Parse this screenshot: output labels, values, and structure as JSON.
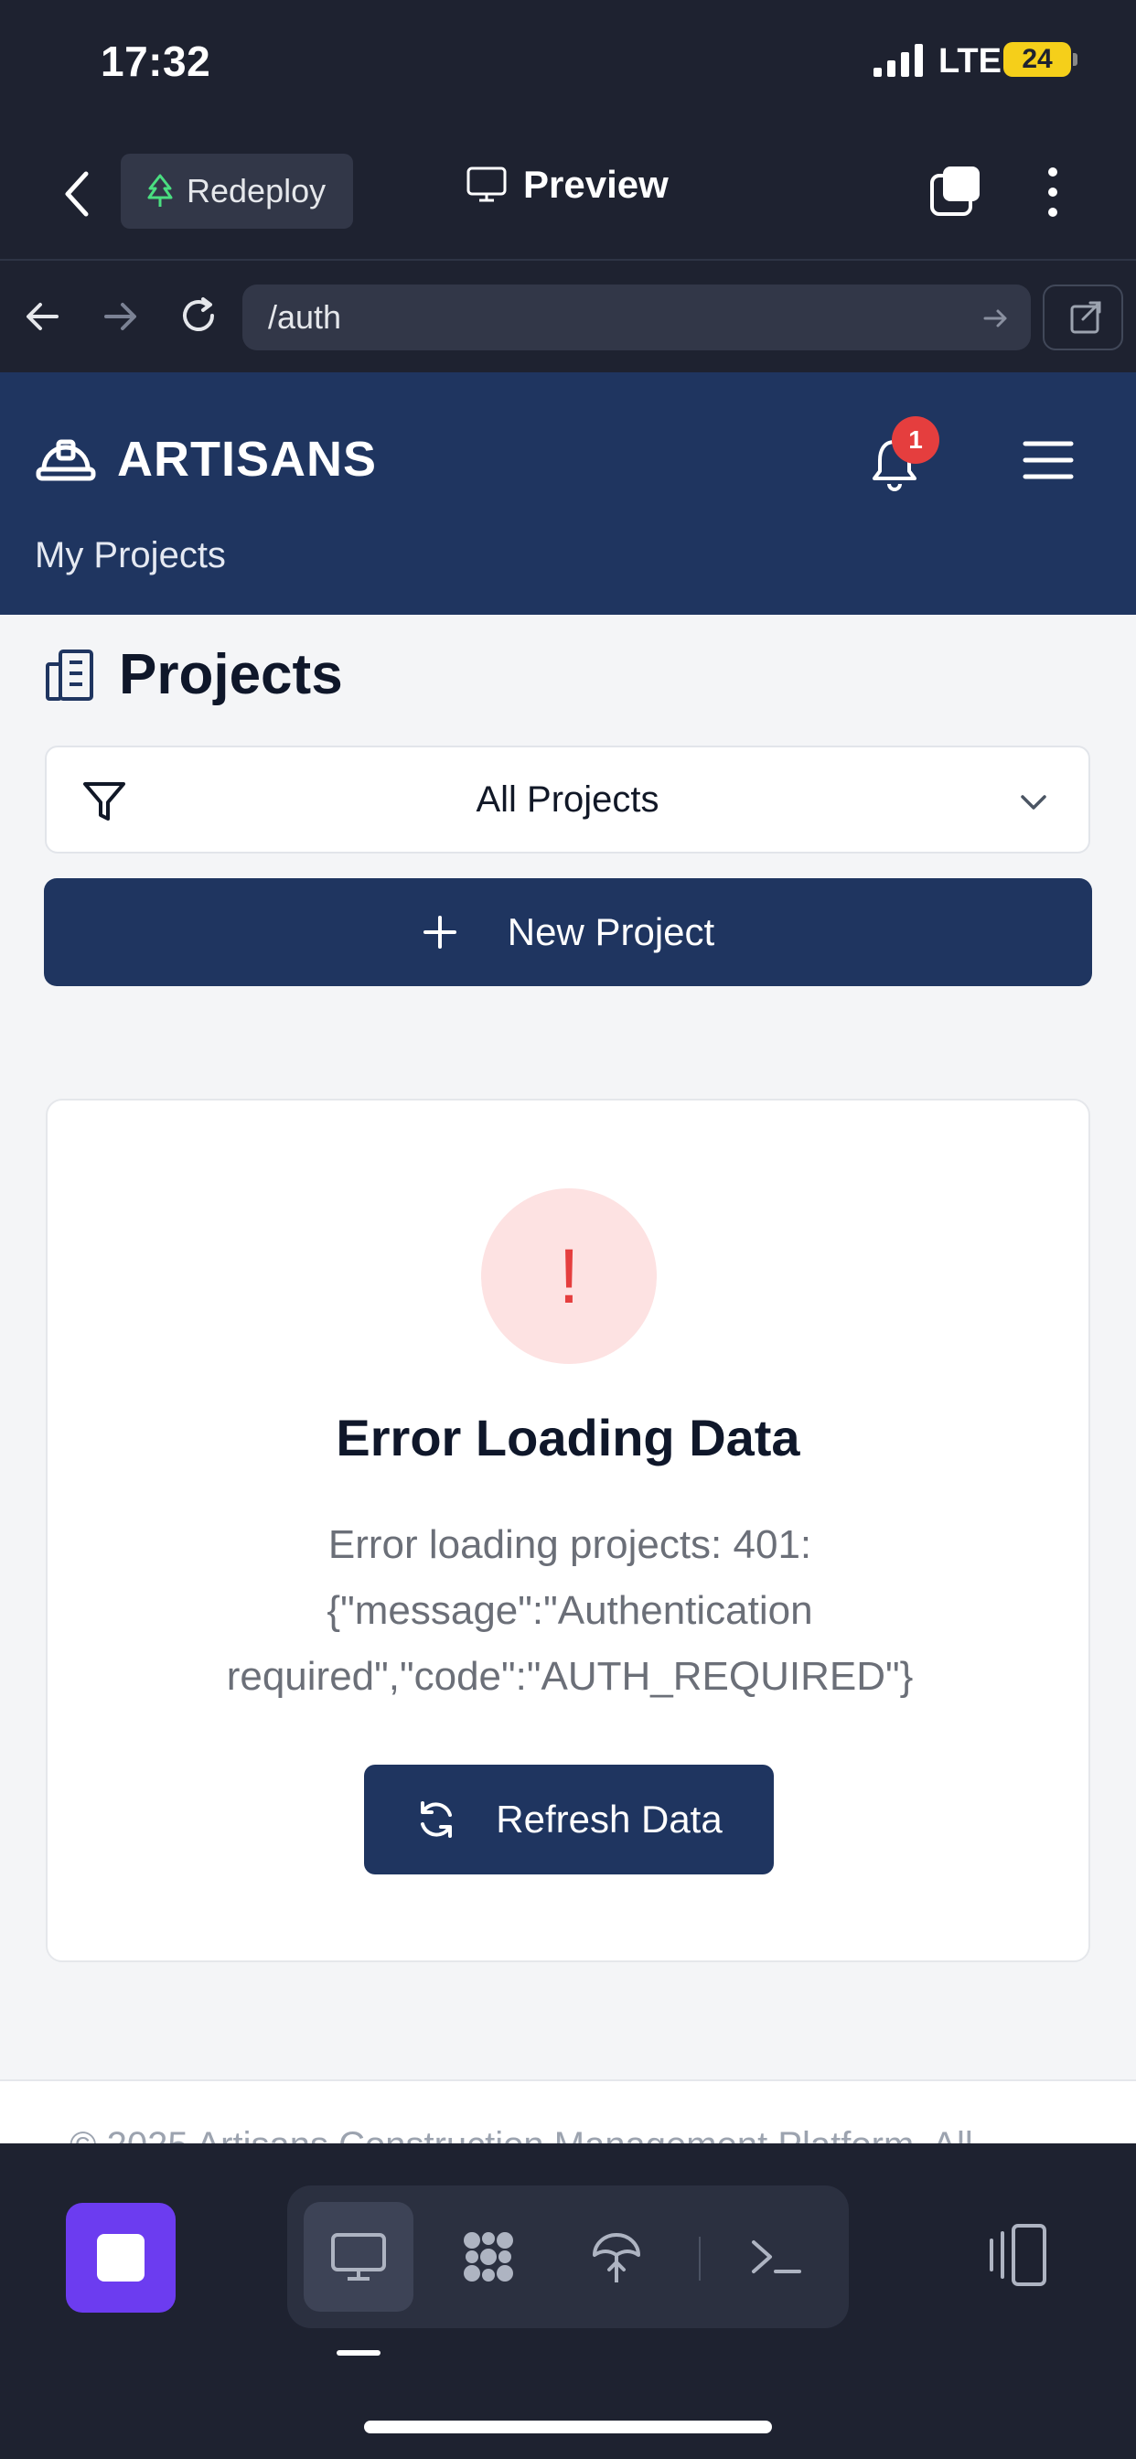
{
  "status_bar": {
    "time": "17:32",
    "network": "LTE",
    "battery": "24"
  },
  "toolbar": {
    "redeploy_label": "Redeploy",
    "preview_label": "Preview"
  },
  "url_bar": {
    "url": "/auth"
  },
  "app": {
    "brand": "ARTISANS",
    "notification_count": "1",
    "subnav": "My Projects",
    "page_title": "Projects",
    "filter": {
      "selected": "All Projects"
    },
    "new_project_label": "New Project",
    "error": {
      "icon_text": "!",
      "title": "Error Loading Data",
      "message": "Error loading projects: 401: {\"message\":\"Authentication required\",\"code\":\"AUTH_REQUIRED\"}",
      "refresh_label": "Refresh Data"
    },
    "footer": "© 2025 Artisans Construction Management Platform. All"
  },
  "colors": {
    "header": "#1f3560",
    "error": "#e53e3e",
    "accent": "#6c3cf0"
  },
  "icons": [
    "back-icon",
    "tree-icon",
    "monitor-icon",
    "tabs-icon",
    "more-icon",
    "forward-icon",
    "reload-icon",
    "open-external-icon",
    "hardhat-icon",
    "bell-icon",
    "hamburger-icon",
    "building-icon",
    "funnel-icon",
    "chevron-down-icon",
    "plus-icon",
    "refresh-icon",
    "stop-icon",
    "desktop-icon",
    "extensions-icon",
    "deploy-icon",
    "terminal-icon",
    "devices-icon"
  ]
}
